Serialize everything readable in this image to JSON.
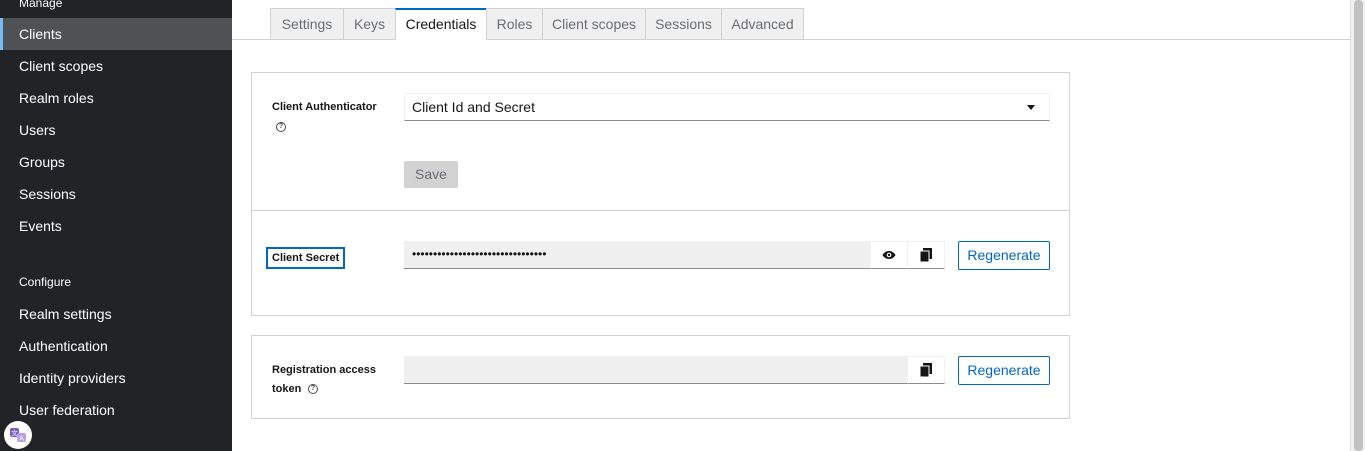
{
  "sidebar": {
    "manage_heading": "Manage",
    "manage_items": [
      {
        "label": "Clients",
        "active": true
      },
      {
        "label": "Client scopes",
        "active": false
      },
      {
        "label": "Realm roles",
        "active": false
      },
      {
        "label": "Users",
        "active": false
      },
      {
        "label": "Groups",
        "active": false
      },
      {
        "label": "Sessions",
        "active": false
      },
      {
        "label": "Events",
        "active": false
      }
    ],
    "configure_heading": "Configure",
    "configure_items": [
      {
        "label": "Realm settings"
      },
      {
        "label": "Authentication"
      },
      {
        "label": "Identity providers"
      },
      {
        "label": "User federation"
      }
    ]
  },
  "tabs": [
    {
      "label": "Settings",
      "active": false
    },
    {
      "label": "Keys",
      "active": false
    },
    {
      "label": "Credentials",
      "active": true
    },
    {
      "label": "Roles",
      "active": false
    },
    {
      "label": "Client scopes",
      "active": false
    },
    {
      "label": "Sessions",
      "active": false
    },
    {
      "label": "Advanced",
      "active": false
    }
  ],
  "credentials": {
    "authenticator_label": "Client Authenticator",
    "authenticator_value": "Client Id and Secret",
    "save_label": "Save",
    "secret_label": "Client Secret",
    "secret_value": "••••••••••••••••••••••••••••••••",
    "regenerate_label": "Regenerate"
  },
  "registration": {
    "label_line1": "Registration access",
    "label_line2": "token",
    "value": "",
    "regenerate_label": "Regenerate"
  },
  "colors": {
    "sidebar_bg": "#212427",
    "active_nav_bg": "#4f5255",
    "accent": "#0066cc"
  }
}
